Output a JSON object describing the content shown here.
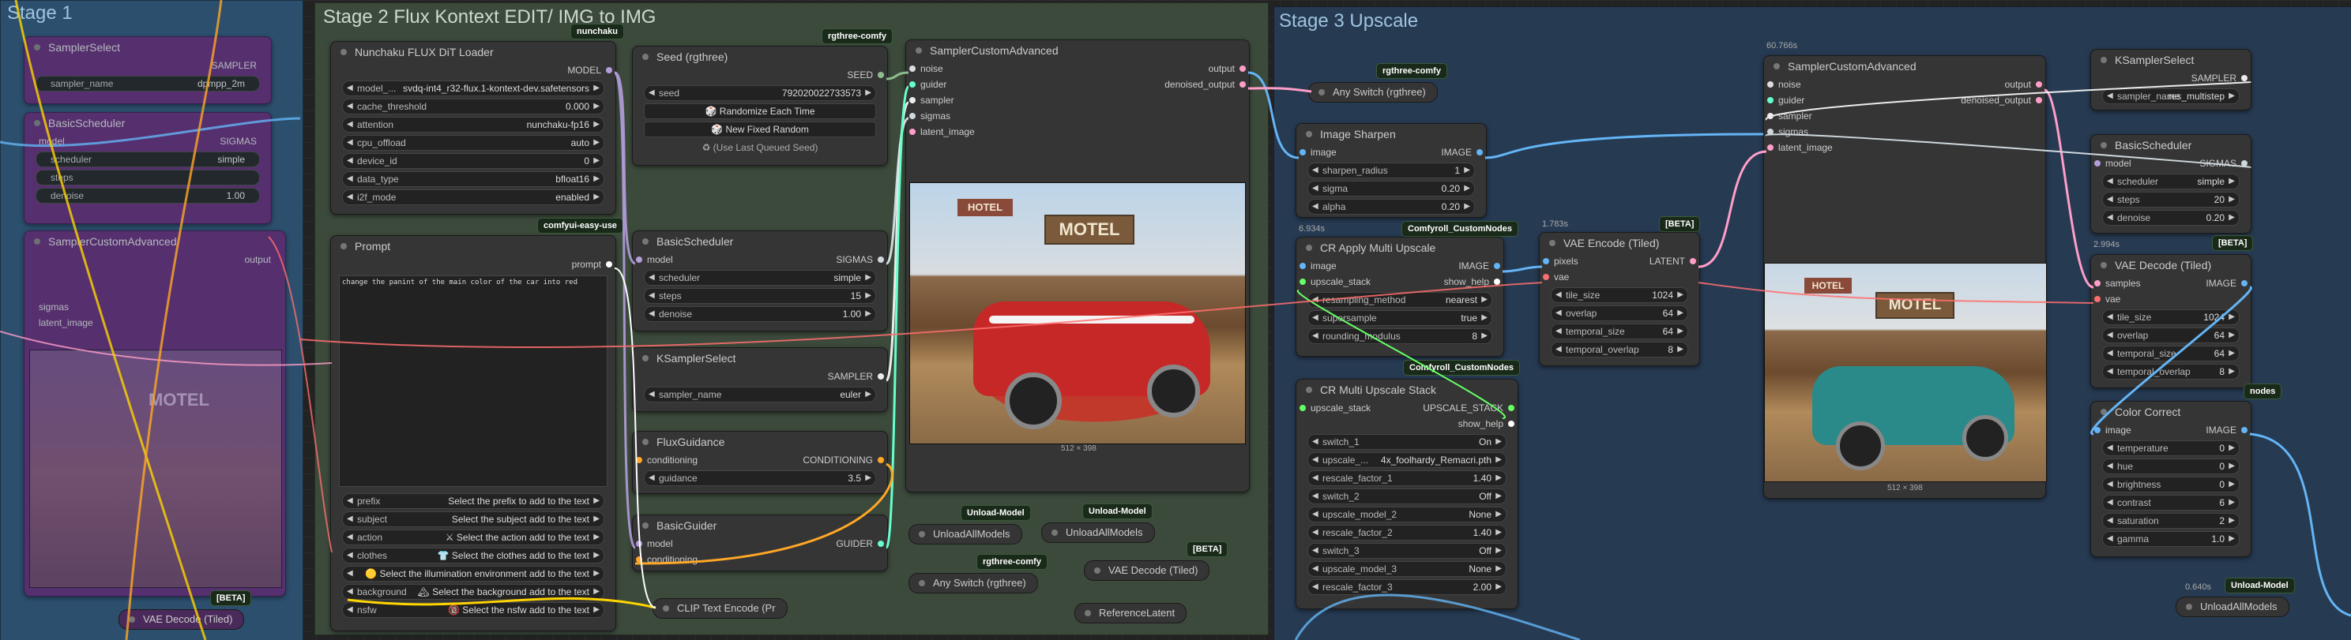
{
  "groups": {
    "stage1": "Stage 1",
    "stage2": "Stage 2 Flux Kontext EDIT/ IMG to IMG",
    "stage3": "Stage 3 Upscale"
  },
  "badges": {
    "nunchaku": "nunchaku",
    "rgthree1": "rgthree-comfy",
    "rgthree2": "rgthree-comfy",
    "rgthree3": "rgthree-comfy",
    "comfyui_easy_use": "comfyui-easy-use",
    "comfyroll1": "Comfyroll_CustomNodes",
    "comfyroll2": "Comfyroll_CustomNodes",
    "beta1": "[BETA]",
    "beta2": "[BETA]",
    "beta3": "[BETA]",
    "beta4": "[BETA]",
    "unload1": "Unload-Model",
    "unload2": "Unload-Model",
    "unload3": "Unload-Model",
    "nodes_frag": "nodes"
  },
  "timings": {
    "t1": "6.934s",
    "t2": "1.783s",
    "t3": "60.766s",
    "t4": "2.994s",
    "t5": "0.640s"
  },
  "stage1": {
    "n1_title": "SamplerSelect",
    "n1_out": "SAMPLER",
    "n1_w": "sampler_name",
    "n1_v": "dpmpp_2m",
    "n2_title": "BasicScheduler",
    "n2_out": "SIGMAS",
    "n2_in": "model",
    "n2_w1": "scheduler",
    "n2_v1": "simple",
    "n2_w2": "steps",
    "n2_w3": "denoise",
    "n2_v3": "1.00",
    "n3_title": "SamplerCustomAdvanced",
    "n3_out": "output",
    "n3_in1": "sigmas",
    "n3_in2": "latent_image",
    "beta": "[BETA]",
    "vae_decode": "VAE Decode (Tiled)"
  },
  "loader": {
    "title": "Nunchaku FLUX DiT Loader",
    "out_model": "MODEL",
    "w_model_l": "model_...",
    "w_model_v": "svdq-int4_r32-flux.1-kontext-dev.safetensors",
    "w_cache_l": "cache_threshold",
    "w_cache_v": "0.000",
    "w_attn_l": "attention",
    "w_attn_v": "nunchaku-fp16",
    "w_cpu_l": "cpu_offload",
    "w_cpu_v": "auto",
    "w_dev_l": "device_id",
    "w_dev_v": "0",
    "w_dtype_l": "data_type",
    "w_dtype_v": "bfloat16",
    "w_i2f_l": "i2f_mode",
    "w_i2f_v": "enabled"
  },
  "prompt": {
    "title": "Prompt",
    "out": "prompt",
    "text": "change the panint of the main color of the car into red",
    "rows": [
      {
        "l": "prefix",
        "v": "Select the prefix to add to the text"
      },
      {
        "l": "subject",
        "v": "Select the subject add to the text"
      },
      {
        "l": "action",
        "v": "⚔ Select the action add to the text"
      },
      {
        "l": "clothes",
        "v": "👕 Select the clothes add to the text"
      },
      {
        "l": "",
        "v": "🟡 Select the illumination environment add to the text"
      },
      {
        "l": "background",
        "v": "🏔 Select the background add to the text"
      },
      {
        "l": "nsfw",
        "v": "🔞 Select the nsfw add to the text"
      }
    ]
  },
  "seed": {
    "title": "Seed (rgthree)",
    "out": "SEED",
    "w_l": "seed",
    "w_v": "792020022733573",
    "b1": "🎲 Randomize Each Time",
    "b2": "🎲 New Fixed Random",
    "b3": "♻ (Use Last Queued Seed)"
  },
  "sched2": {
    "title": "BasicScheduler",
    "in": "model",
    "out": "SIGMAS",
    "w1_l": "scheduler",
    "w1_v": "simple",
    "w2_l": "steps",
    "w2_v": "15",
    "w3_l": "denoise",
    "w3_v": "1.00"
  },
  "ksel2": {
    "title": "KSamplerSelect",
    "out": "SAMPLER",
    "w_l": "sampler_name",
    "w_v": "euler"
  },
  "fluxg": {
    "title": "FluxGuidance",
    "in": "conditioning",
    "out": "CONDITIONING",
    "w_l": "guidance",
    "w_v": "3.5"
  },
  "bguider": {
    "title": "BasicGuider",
    "in1": "model",
    "in2": "conditioning",
    "out": "GUIDER"
  },
  "clip": {
    "title": "CLIP Text Encode (Pr"
  },
  "sca2": {
    "title": "SamplerCustomAdvanced",
    "in1": "noise",
    "in2": "guider",
    "in3": "sampler",
    "in4": "sigmas",
    "in5": "latent_image",
    "out1": "output",
    "out2": "denoised_output",
    "caption": "512 × 398"
  },
  "collapsed2": {
    "unload1": "UnloadAllModels",
    "unload2": "UnloadAllModels",
    "anyswitch": "Any Switch (rgthree)",
    "vaedec": "VAE Decode (Tiled)",
    "reflatent": "ReferenceLatent"
  },
  "stage3": {
    "anyswitch": "Any Switch (rgthree)",
    "sharpen": {
      "title": "Image Sharpen",
      "in": "image",
      "out": "IMAGE",
      "w1_l": "sharpen_radius",
      "w1_v": "1",
      "w2_l": "sigma",
      "w2_v": "0.20",
      "w3_l": "alpha",
      "w3_v": "0.20"
    },
    "applyups": {
      "title": "CR Apply Multi Upscale",
      "in1": "image",
      "in2": "upscale_stack",
      "out1": "IMAGE",
      "out2": "show_help",
      "w1_l": "resampling_method",
      "w1_v": "nearest",
      "w2_l": "supersample",
      "w2_v": "true",
      "w3_l": "rounding_modulus",
      "w3_v": "8"
    },
    "stack": {
      "title": "CR Multi Upscale Stack",
      "in": "upscale_stack",
      "out1": "UPSCALE_STACK",
      "out2": "show_help",
      "rows": [
        {
          "l": "switch_1",
          "v": "On"
        },
        {
          "l": "upscale_...",
          "v": "4x_foolhardy_Remacri.pth"
        },
        {
          "l": "rescale_factor_1",
          "v": "1.40"
        },
        {
          "l": "switch_2",
          "v": "Off"
        },
        {
          "l": "upscale_model_2",
          "v": "None"
        },
        {
          "l": "rescale_factor_2",
          "v": "1.40"
        },
        {
          "l": "switch_3",
          "v": "Off"
        },
        {
          "l": "upscale_model_3",
          "v": "None"
        },
        {
          "l": "rescale_factor_3",
          "v": "2.00"
        }
      ]
    },
    "vaeenc": {
      "title": "VAE Encode (Tiled)",
      "in1": "pixels",
      "in2": "vae",
      "out": "LATENT",
      "w1_l": "tile_size",
      "w1_v": "1024",
      "w2_l": "overlap",
      "w2_v": "64",
      "w3_l": "temporal_size",
      "w3_v": "64",
      "w4_l": "temporal_overlap",
      "w4_v": "8"
    },
    "sca3": {
      "title": "SamplerCustomAdvanced",
      "in1": "noise",
      "in2": "guider",
      "in3": "sampler",
      "in4": "sigmas",
      "in5": "latent_image",
      "out1": "output",
      "out2": "denoised_output",
      "caption": "512 × 398"
    },
    "ksel3": {
      "title": "KSamplerSelect",
      "out": "SAMPLER",
      "w_l": "sampler_name",
      "w_v": "res_multistep"
    },
    "sched3": {
      "title": "BasicScheduler",
      "in": "model",
      "out": "SIGMAS",
      "w1_l": "scheduler",
      "w1_v": "simple",
      "w2_l": "steps",
      "w2_v": "20",
      "w3_l": "denoise",
      "w3_v": "0.20"
    },
    "vaedec3": {
      "title": "VAE Decode (Tiled)",
      "in1": "samples",
      "in2": "vae",
      "out": "IMAGE",
      "w1_l": "tile_size",
      "w1_v": "1024",
      "w2_l": "overlap",
      "w2_v": "64",
      "w3_l": "temporal_size",
      "w3_v": "64",
      "w4_l": "temporal_overlap",
      "w4_v": "8"
    },
    "color": {
      "title": "Color Correct",
      "in": "image",
      "out": "IMAGE",
      "rows": [
        {
          "l": "temperature",
          "v": "0"
        },
        {
          "l": "hue",
          "v": "0"
        },
        {
          "l": "brightness",
          "v": "0"
        },
        {
          "l": "contrast",
          "v": "6"
        },
        {
          "l": "saturation",
          "v": "2"
        },
        {
          "l": "gamma",
          "v": "1.0"
        }
      ]
    },
    "unload": "UnloadAllModels"
  },
  "image_text": {
    "motel": "MOTEL",
    "hotel": "HOTEL"
  },
  "colors": {
    "stage1_group": "#2c4f6e",
    "stage2_group": "#3c4a3c",
    "stage3_group": "#263a52",
    "wire_model": "#b39ddb",
    "wire_image": "#64b5f6",
    "wire_latent": "#ff9ec8",
    "wire_cond": "#ffa726",
    "wire_vae": "#ff6e6e",
    "wire_clip": "#ffd500",
    "wire_sampler": "#ececec",
    "wire_sigmas": "#cfd8dc",
    "wire_guider": "#66ffcc"
  }
}
